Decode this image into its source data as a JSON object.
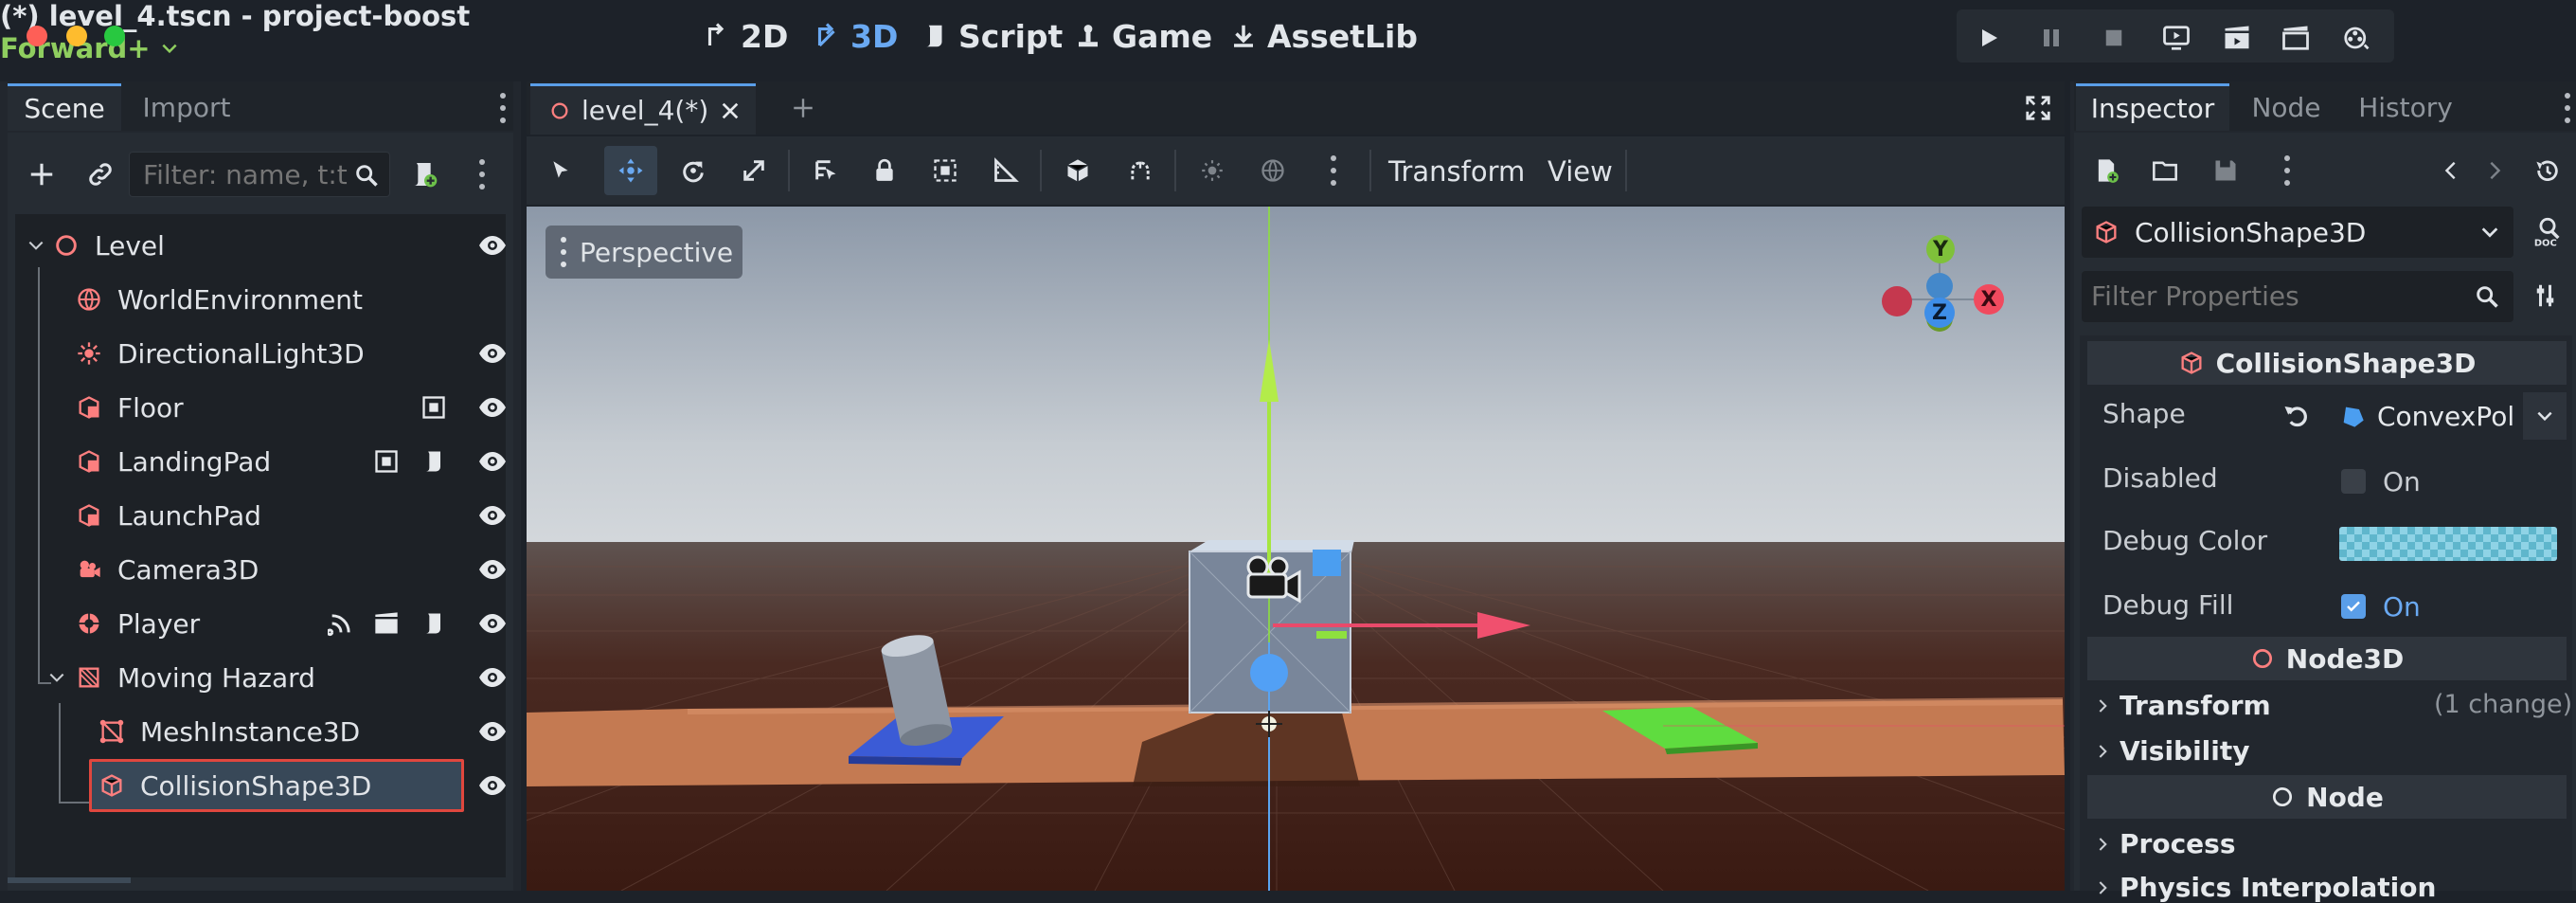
{
  "window": {
    "title": "(*) level_4.tscn - project-boost"
  },
  "workspaces": [
    "2D",
    "3D",
    "Script",
    "Game",
    "AssetLib"
  ],
  "renderer": "Forward+",
  "left_dock": {
    "tabs": [
      "Scene",
      "Import"
    ],
    "filter_placeholder": "Filter: name, t:t",
    "tree": [
      {
        "label": "Level",
        "icon": "node3d-icon"
      },
      {
        "label": "WorldEnvironment",
        "icon": "world-environment-icon"
      },
      {
        "label": "DirectionalLight3D",
        "icon": "directional-light-icon"
      },
      {
        "label": "Floor",
        "icon": "csg-box-icon"
      },
      {
        "label": "LandingPad",
        "icon": "csg-box-icon"
      },
      {
        "label": "LaunchPad",
        "icon": "csg-box-icon"
      },
      {
        "label": "Camera3D",
        "icon": "camera-icon"
      },
      {
        "label": "Player",
        "icon": "rigidbody-icon"
      },
      {
        "label": "Moving Hazard",
        "icon": "animatable-body-icon"
      },
      {
        "label": "MeshInstance3D",
        "icon": "mesh-instance-icon"
      },
      {
        "label": "CollisionShape3D",
        "icon": "collision-shape-icon"
      }
    ]
  },
  "editor": {
    "tab": "level_4(*)",
    "toolbar": {
      "transform_menu": "Transform",
      "view_menu": "View"
    },
    "viewport_label": "Perspective",
    "gizmo_axes": {
      "x": "X",
      "y": "Y",
      "z": "Z"
    }
  },
  "inspector": {
    "tabs": [
      "Inspector",
      "Node",
      "History"
    ],
    "object_name": "CollisionShape3D",
    "filter_placeholder": "Filter Properties",
    "section_title": "CollisionShape3D",
    "properties": {
      "shape_label": "Shape",
      "shape_value": "ConvexPol",
      "disabled_label": "Disabled",
      "disabled_value": "On",
      "debug_color_label": "Debug Color",
      "debug_fill_label": "Debug Fill",
      "debug_fill_value": "On"
    },
    "node3d_section": "Node3D",
    "transform_group": "Transform",
    "transform_changes": "(1 change)",
    "visibility_group": "Visibility",
    "node_section": "Node",
    "process_group": "Process",
    "physics_interp_group": "Physics Interpolation"
  },
  "colors": {
    "accent": "#5a9ee8",
    "selection_outline": "#e0473e",
    "renderer": "#8fce5f",
    "node3d": "#fc7f7f"
  }
}
